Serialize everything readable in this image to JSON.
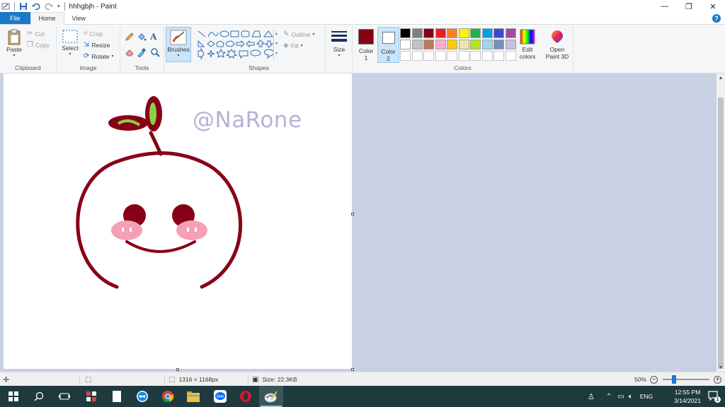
{
  "window": {
    "title": "hhhgbjh - Paint",
    "controls": {
      "minimize": "—",
      "restore": "❐",
      "close": "✕"
    }
  },
  "tabs": [
    {
      "label": "File"
    },
    {
      "label": "Home"
    },
    {
      "label": "View"
    }
  ],
  "ribbon": {
    "clipboard": {
      "label": "Clipboard",
      "paste": "Paste",
      "cut": "Cut",
      "copy": "Copy"
    },
    "image": {
      "label": "Image",
      "select": "Select",
      "crop": "Crop",
      "resize": "Resize",
      "rotate": "Rotate"
    },
    "tools": {
      "label": "Tools"
    },
    "brushes": {
      "label": "Brushes"
    },
    "shapes": {
      "label": "Shapes",
      "outline": "Outline",
      "fill": "Fill"
    },
    "size": {
      "label": "Size"
    },
    "colors": {
      "label": "Colors",
      "color1_label": "Color",
      "color1_num": "1",
      "color2_label": "Color",
      "color2_num": "2",
      "edit_colors_line1": "Edit",
      "edit_colors_line2": "colors",
      "color1_value": "#880015",
      "color2_value": "#ffffff",
      "palette_row1": [
        "#000000",
        "#7f7f7f",
        "#880015",
        "#ed1c24",
        "#ff7f27",
        "#fff200",
        "#22b14c",
        "#00a2e8",
        "#3f48cc",
        "#a349a4"
      ],
      "palette_row2": [
        "#ffffff",
        "#c3c3c3",
        "#b97a57",
        "#ffaec9",
        "#ffc90e",
        "#efe4b0",
        "#b5e61d",
        "#99d9ea",
        "#7092be",
        "#c8bfe7"
      ]
    },
    "paint3d": {
      "line1": "Open",
      "line2": "Paint 3D"
    }
  },
  "canvas": {
    "watermark": "@NaRone"
  },
  "statusbar": {
    "dimensions": "1316 × 1168px",
    "size": "Size: 22.3KB",
    "zoom": "50%",
    "zoom_level": 0.5
  },
  "taskbar": {
    "language": "ENG",
    "time": "12:55 PM",
    "date": "3/14/2021",
    "notification_count": "1"
  }
}
